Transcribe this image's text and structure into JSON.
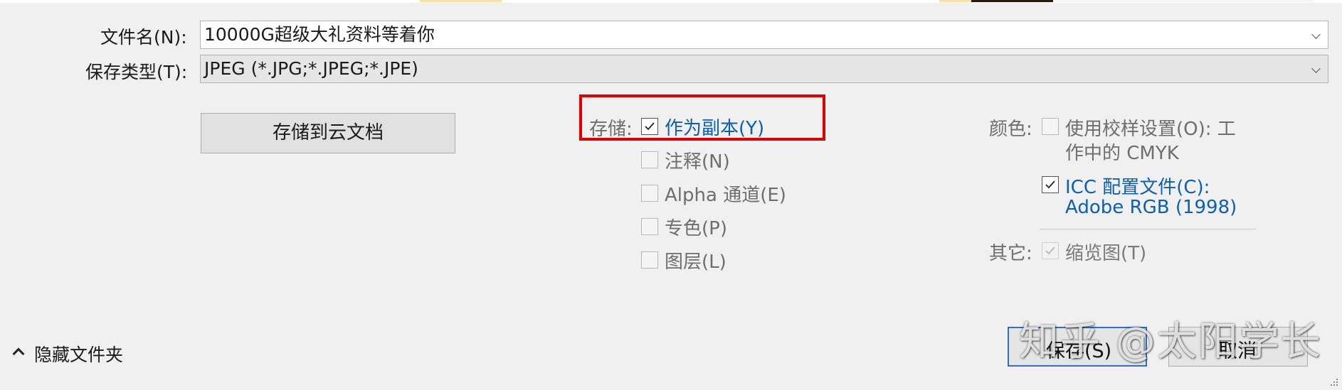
{
  "filename": {
    "label": "文件名(N):",
    "value": "10000G超级大礼资料等着你"
  },
  "filetype": {
    "label": "保存类型(T):",
    "value": "JPEG (*.JPG;*.JPEG;*.JPE)"
  },
  "cloud_button": "存储到云文档",
  "save_options": {
    "label": "存储:",
    "as_copy": "作为副本(Y)",
    "annotations": "注释(N)",
    "alpha": "Alpha 通道(E)",
    "spot": "专色(P)",
    "layers": "图层(L)"
  },
  "color_options": {
    "label": "颜色:",
    "proof_line1": "使用校样设置(O):  工",
    "proof_line2": "作中的 CMYK",
    "icc_line1": "ICC 配置文件(C):",
    "icc_line2": "Adobe RGB (1998)"
  },
  "other_options": {
    "label": "其它:",
    "thumbnail": "缩览图(T)"
  },
  "hide_folders": "隐藏文件夹",
  "save_button": "保存(S)",
  "cancel_button": "取消",
  "watermark": "知乎 @太阳学长",
  "accent_color": "#0a5fb8",
  "highlight_color": "#e00000"
}
